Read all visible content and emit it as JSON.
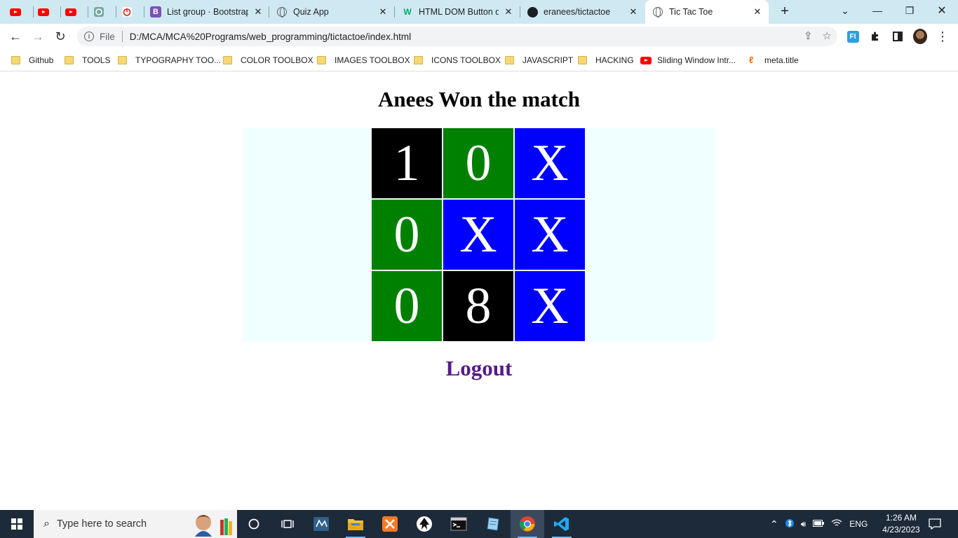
{
  "browser": {
    "tabs": [
      {
        "title": "",
        "icon": "youtube-icon"
      },
      {
        "title": "",
        "icon": "youtube-icon"
      },
      {
        "title": "",
        "icon": "youtube-icon"
      },
      {
        "title": "",
        "icon": "chatgpt-icon"
      },
      {
        "title": "",
        "icon": "timer-icon"
      },
      {
        "title": "List group · Bootstrap",
        "icon": "bootstrap-icon"
      },
      {
        "title": "Quiz App",
        "icon": "globe-icon"
      },
      {
        "title": "HTML DOM Button di",
        "icon": "w3schools-icon"
      },
      {
        "title": "eranees/tictactoe",
        "icon": "github-icon"
      },
      {
        "title": "Tic Tac Toe",
        "icon": "globe-icon",
        "active": true
      }
    ],
    "new_tab_label": "+",
    "address": {
      "scheme_label": "File",
      "url": "D:/MCA/MCA%20Programs/web_programming/tictactoe/index.html"
    },
    "extension_label": "FI",
    "bookmarks": [
      {
        "label": "Github",
        "type": "folder"
      },
      {
        "label": "TOOLS",
        "type": "folder"
      },
      {
        "label": "TYPOGRAPHY TOO...",
        "type": "folder"
      },
      {
        "label": "COLOR TOOLBOX",
        "type": "folder"
      },
      {
        "label": "IMAGES TOOLBOX",
        "type": "folder"
      },
      {
        "label": "ICONS TOOLBOX",
        "type": "folder"
      },
      {
        "label": "JAVASCRIPT",
        "type": "folder"
      },
      {
        "label": "HACKING",
        "type": "folder"
      },
      {
        "label": "Sliding Window Intr...",
        "type": "youtube"
      },
      {
        "label": "meta.title",
        "type": "link"
      }
    ]
  },
  "page": {
    "heading": "Anees Won the match",
    "board": [
      {
        "value": "1",
        "color": "#000000"
      },
      {
        "value": "0",
        "color": "#008000"
      },
      {
        "value": "X",
        "color": "#0000ff"
      },
      {
        "value": "0",
        "color": "#008000"
      },
      {
        "value": "X",
        "color": "#0000ff"
      },
      {
        "value": "X",
        "color": "#0000ff"
      },
      {
        "value": "0",
        "color": "#008000"
      },
      {
        "value": "8",
        "color": "#000000"
      },
      {
        "value": "X",
        "color": "#0000ff"
      }
    ],
    "board_background": "#f0ffff",
    "logout_label": "Logout",
    "logout_color": "#551a8b"
  },
  "taskbar": {
    "search_placeholder": "Type here to search",
    "tray_language": "ENG",
    "time": "1:26 AM",
    "date": "4/23/2023"
  }
}
